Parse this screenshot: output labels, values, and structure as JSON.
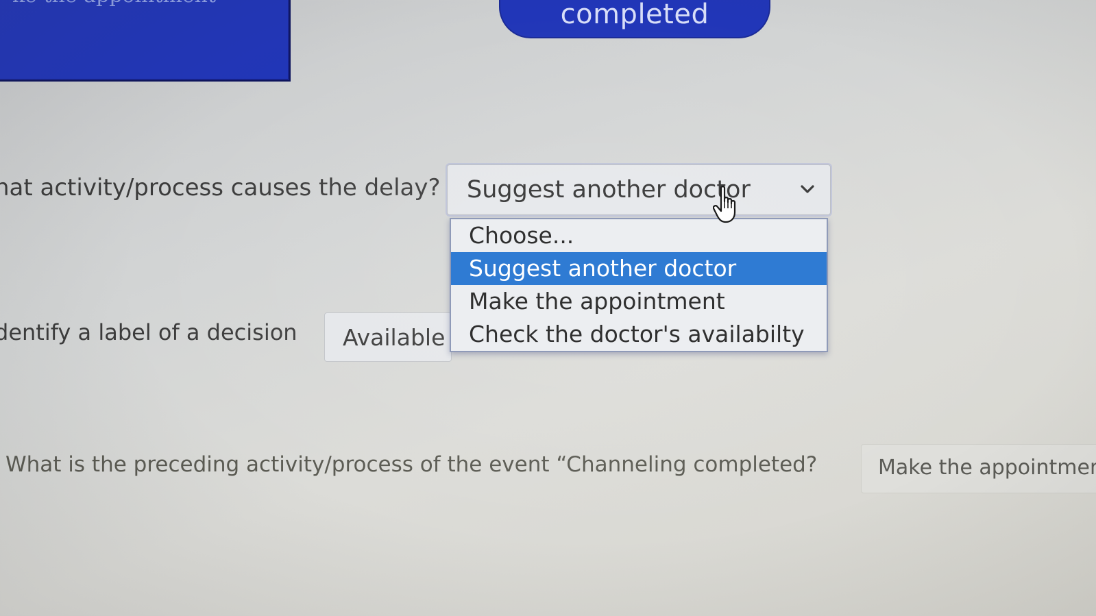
{
  "diagram": {
    "activity_box_text": "ke the appointment",
    "event_pill_text": "completed"
  },
  "questions": [
    {
      "prompt": "hat activity/process causes the delay?",
      "selected_value": "Suggest another doctor",
      "dropdown_open": true,
      "options": [
        "Choose...",
        "Suggest another doctor",
        "Make the appointment",
        "Check the doctor's availabilty"
      ],
      "highlighted_option": "Suggest another doctor"
    },
    {
      "prompt": "dentify  a label of a decision",
      "selected_value": "Available"
    },
    {
      "prompt": "What is the preceding activity/process of the event “Channeling completed?",
      "selected_value": "Make the appointmen"
    }
  ],
  "colors": {
    "diagram_fill": "#2136b8",
    "highlight": "#2f7bd3",
    "background": "#d3d5d5"
  },
  "icons": {
    "select_arrow": "chevron-down-icon",
    "pointer": "hand-pointer-icon"
  }
}
